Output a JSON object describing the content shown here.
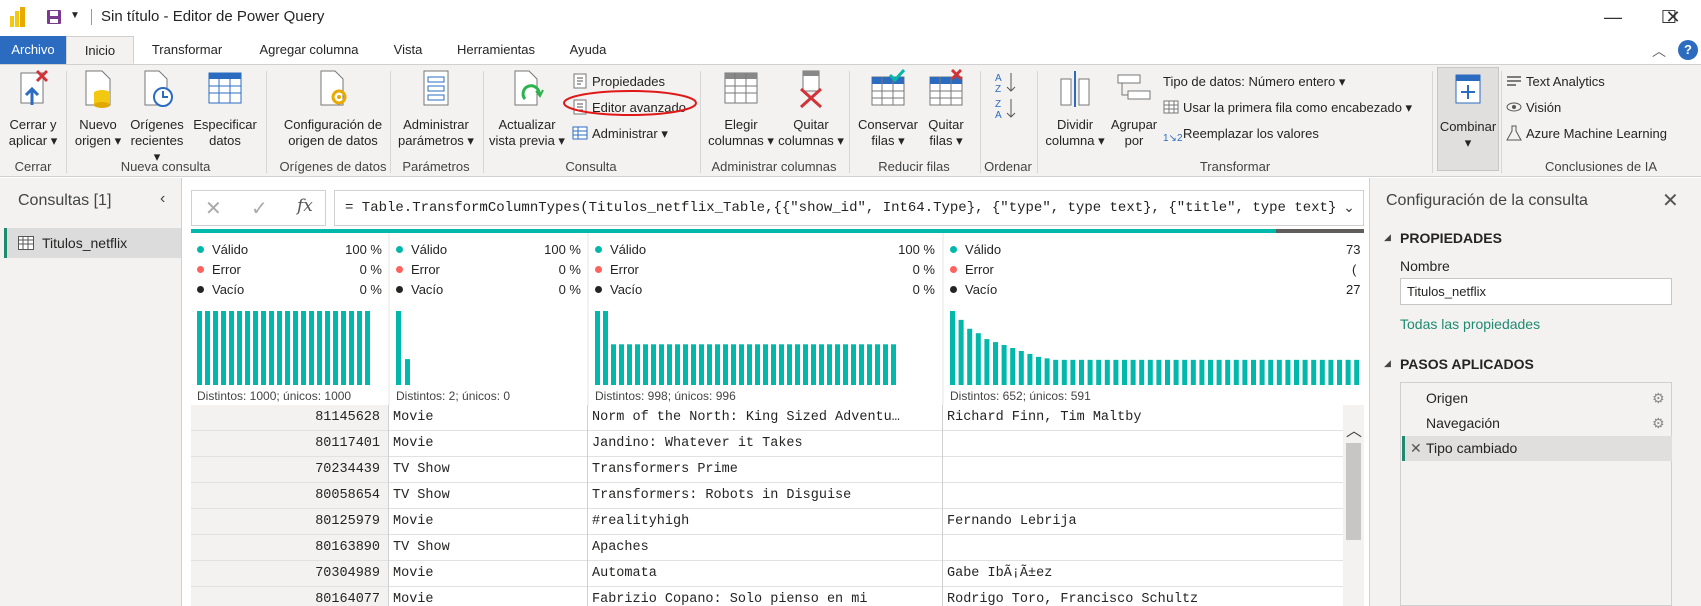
{
  "window": {
    "title": "Sin título - Editor de Power Query"
  },
  "tabs": [
    "Archivo",
    "Inicio",
    "Transformar",
    "Agregar columna",
    "Vista",
    "Herramientas",
    "Ayuda"
  ],
  "ribbon": {
    "cerrar": {
      "btn": [
        "Cerrar y",
        "aplicar"
      ],
      "group": "Cerrar"
    },
    "nueva_consulta": {
      "nuevo": [
        "Nuevo",
        "origen"
      ],
      "origenes": [
        "Orígenes",
        "recientes"
      ],
      "especificar": [
        "Especificar",
        "datos"
      ],
      "group": "Nueva consulta"
    },
    "origenes_datos": {
      "btn": [
        "Configuración de",
        "origen de datos"
      ],
      "group": "Orígenes de datos"
    },
    "parametros": {
      "btn": [
        "Administrar",
        "parámetros"
      ],
      "group": "Parámetros"
    },
    "consulta": {
      "actualizar": [
        "Actualizar",
        "vista previa"
      ],
      "propiedades": "Propiedades",
      "editor": "Editor avanzado",
      "administrar": "Administrar",
      "group": "Consulta"
    },
    "admin_columnas": {
      "elegir": [
        "Elegir",
        "columnas"
      ],
      "quitar": [
        "Quitar",
        "columnas"
      ],
      "group": "Administrar columnas"
    },
    "reducir_filas": {
      "conservar": [
        "Conservar",
        "filas"
      ],
      "quitar": [
        "Quitar",
        "filas"
      ],
      "group": "Reducir filas"
    },
    "ordenar": {
      "group": "Ordenar"
    },
    "transformar": {
      "dividir": [
        "Dividir",
        "columna"
      ],
      "agrupar": [
        "Agrupar",
        "por"
      ],
      "tipo_datos": "Tipo de datos: Número entero",
      "primera_fila": "Usar la primera fila como encabezado",
      "reemplazar": "Reemplazar los valores",
      "group": "Transformar"
    },
    "combinar": {
      "btn": "Combinar"
    },
    "ia": {
      "text_analytics": "Text Analytics",
      "vision": "Visión",
      "azure": "Azure Machine Learning",
      "group": "Conclusiones de IA"
    }
  },
  "queries": {
    "header": "Consultas [1]",
    "items": [
      "Titulos_netflix"
    ]
  },
  "formula": "= Table.TransformColumnTypes(Titulos_netflix_Table,{{\"show_id\", Int64.Type}, {\"type\", type text}, {\"title\", type text},",
  "profile_labels": {
    "valid": "Válido",
    "error": "Error",
    "empty": "Vacío"
  },
  "columns": [
    {
      "valid": "100 %",
      "error": "0 %",
      "empty": "0 %",
      "dist": "Distintos: 1000; únicos: 1000"
    },
    {
      "valid": "100 %",
      "error": "0 %",
      "empty": "0 %",
      "dist": "Distintos: 2; únicos: 0"
    },
    {
      "valid": "100 %",
      "error": "0 %",
      "empty": "0 %",
      "dist": "Distintos: 998; únicos: 996"
    },
    {
      "valid": "73",
      "error": "(",
      "empty": "27",
      "dist": "Distintos: 652; únicos: 591"
    }
  ],
  "rows": [
    [
      "81145628",
      "Movie",
      "Norm of the North: King Sized Adventu…",
      "Richard Finn, Tim Maltby"
    ],
    [
      "80117401",
      "Movie",
      "Jandino: Whatever it Takes",
      ""
    ],
    [
      "70234439",
      "TV Show",
      "Transformers Prime",
      ""
    ],
    [
      "80058654",
      "TV Show",
      "Transformers: Robots in Disguise",
      ""
    ],
    [
      "80125979",
      "Movie",
      "#realityhigh",
      "Fernando Lebrija"
    ],
    [
      "80163890",
      "TV Show",
      "Apaches",
      ""
    ],
    [
      "70304989",
      "Movie",
      "Automata",
      "Gabe IbÃ¡Ã±ez"
    ],
    [
      "80164077",
      "Movie",
      "Fabrizio Copano: Solo pienso en mi",
      "Rodrigo Toro, Francisco Schultz"
    ]
  ],
  "settings": {
    "title": "Configuración de la consulta",
    "props_header": "PROPIEDADES",
    "name_label": "Nombre",
    "name_value": "Titulos_netflix",
    "all_props": "Todas las propiedades",
    "steps_header": "PASOS APLICADOS",
    "steps": [
      "Origen",
      "Navegación",
      "Tipo cambiado"
    ]
  },
  "colors": {
    "accent": "#2b6cc1",
    "teal": "#01b8aa",
    "error": "#fd625e",
    "selected_step": "#e1dfdd"
  }
}
